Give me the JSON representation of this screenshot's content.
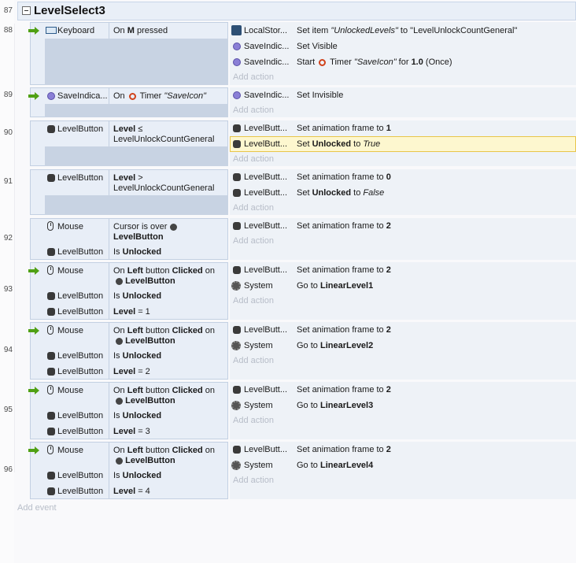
{
  "group": {
    "line": "87",
    "title": "LevelSelect3"
  },
  "events": [
    {
      "line": "88"
    },
    {
      "line": "89"
    },
    {
      "line": "90"
    },
    {
      "line": "91"
    },
    {
      "line": "92"
    },
    {
      "line": "93"
    },
    {
      "line": "94"
    },
    {
      "line": "95"
    },
    {
      "line": "96"
    }
  ],
  "e88": {
    "cond_obj": "Keyboard",
    "cond_pre": "On ",
    "cond_key": "M",
    "cond_post": " pressed",
    "a1_obj": "LocalStor...",
    "a1_pre": "Set item ",
    "a1_item": "\"UnlockedLevels\"",
    "a1_mid": " to ",
    "a1_val": "\"LevelUnlockCountGeneral\"",
    "a2_obj": "SaveIndic...",
    "a2_text": "Set Visible",
    "a3_obj": "SaveIndic...",
    "a3_pre": "Start ",
    "a3_timer": "Timer",
    "a3_name": "\"SaveIcon\"",
    "a3_for": " for ",
    "a3_dur": "1.0",
    "a3_mode": " (Once)"
  },
  "e89": {
    "cond_obj": "SaveIndica...",
    "cond_pre": "On",
    "cond_timer": "Timer",
    "cond_name": "\"SaveIcon\"",
    "a1_obj": "SaveIndic...",
    "a1_text": "Set Invisible"
  },
  "e90": {
    "cond_obj": "LevelButton",
    "cond_var": "Level",
    "cond_op": " ≤",
    "cond_val": "LevelUnlockCountGeneral",
    "a1_obj": "LevelButt...",
    "a1_pre": "Set animation frame to ",
    "a1_val": "1",
    "a2_obj": "LevelButt...",
    "a2_pre": "Set ",
    "a2_var": "Unlocked",
    "a2_mid": " to ",
    "a2_val": "True"
  },
  "e91": {
    "cond_obj": "LevelButton",
    "cond_var": "Level",
    "cond_op": " >",
    "cond_val": "LevelUnlockCountGeneral",
    "a1_obj": "LevelButt...",
    "a1_pre": "Set animation frame to ",
    "a1_val": "0",
    "a2_obj": "LevelButt...",
    "a2_pre": "Set ",
    "a2_var": "Unlocked",
    "a2_mid": " to ",
    "a2_val": "False"
  },
  "e92": {
    "c1_obj": "Mouse",
    "c1_pre": "Cursor is over",
    "c1_target": "LevelButton",
    "c2_obj": "LevelButton",
    "c2_pre": "Is ",
    "c2_var": "Unlocked",
    "a1_obj": "LevelButt...",
    "a1_pre": "Set animation frame to ",
    "a1_val": "2"
  },
  "e93": {
    "c1_obj": "Mouse",
    "c1_pre": "On ",
    "c1_btn": "Left",
    "c1_mid": " button ",
    "c1_act": "Clicked",
    "c1_on": " on",
    "c1_target": "LevelButton",
    "c2_obj": "LevelButton",
    "c2_pre": "Is ",
    "c2_var": "Unlocked",
    "c3_obj": "LevelButton",
    "c3_var": "Level",
    "c3_rest": " = 1",
    "a1_obj": "LevelButt...",
    "a1_pre": "Set animation frame to ",
    "a1_val": "2",
    "a2_obj": "System",
    "a2_pre": "Go to ",
    "a2_val": "LinearLevel1"
  },
  "e94": {
    "c1_obj": "Mouse",
    "c1_pre": "On ",
    "c1_btn": "Left",
    "c1_mid": " button ",
    "c1_act": "Clicked",
    "c1_on": " on",
    "c1_target": "LevelButton",
    "c2_obj": "LevelButton",
    "c2_pre": "Is ",
    "c2_var": "Unlocked",
    "c3_obj": "LevelButton",
    "c3_var": "Level",
    "c3_rest": " = 2",
    "a1_obj": "LevelButt...",
    "a1_pre": "Set animation frame to ",
    "a1_val": "2",
    "a2_obj": "System",
    "a2_pre": "Go to ",
    "a2_val": "LinearLevel2"
  },
  "e95": {
    "c1_obj": "Mouse",
    "c1_pre": "On ",
    "c1_btn": "Left",
    "c1_mid": " button ",
    "c1_act": "Clicked",
    "c1_on": " on",
    "c1_target": "LevelButton",
    "c2_obj": "LevelButton",
    "c2_pre": "Is ",
    "c2_var": "Unlocked",
    "c3_obj": "LevelButton",
    "c3_var": "Level",
    "c3_rest": " = 3",
    "a1_obj": "LevelButt...",
    "a1_pre": "Set animation frame to ",
    "a1_val": "2",
    "a2_obj": "System",
    "a2_pre": "Go to ",
    "a2_val": "LinearLevel3"
  },
  "e96": {
    "c1_obj": "Mouse",
    "c1_pre": "On ",
    "c1_btn": "Left",
    "c1_mid": " button ",
    "c1_act": "Clicked",
    "c1_on": " on",
    "c1_target": "LevelButton",
    "c2_obj": "LevelButton",
    "c2_pre": "Is ",
    "c2_var": "Unlocked",
    "c3_obj": "LevelButton",
    "c3_var": "Level",
    "c3_rest": " = 4",
    "a1_obj": "LevelButt...",
    "a1_pre": "Set animation frame to ",
    "a1_val": "2",
    "a2_obj": "System",
    "a2_pre": "Go to ",
    "a2_val": "LinearLevel4"
  },
  "add_action": "Add action",
  "add_event": "Add event",
  "icons": {
    "trigger": "trigger-arrow-icon",
    "mouse": "mouse-icon",
    "keyboard": "keyboard-icon",
    "sprite": "sprite-icon",
    "save": "save-indicator-icon",
    "storage": "local-storage-icon",
    "timer": "timer-icon",
    "system": "gear-icon"
  },
  "colors": {
    "condition_bg": "#e8eef7",
    "action_bg": "#eef2f7",
    "highlight": "#fdf7cf",
    "trigger": "#4fa014",
    "timer": "#d0421b"
  }
}
